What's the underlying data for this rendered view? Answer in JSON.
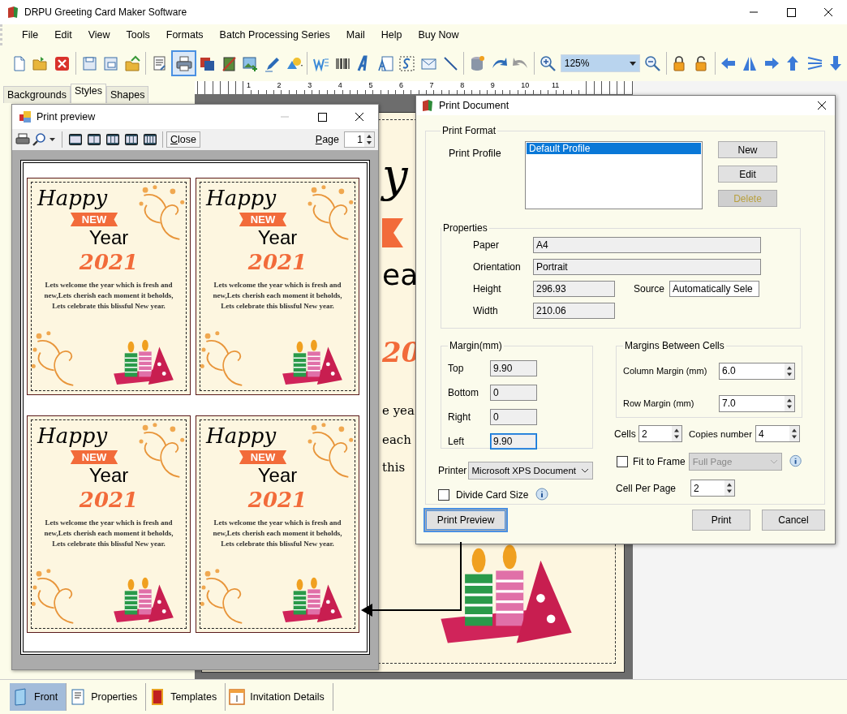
{
  "window": {
    "title": "DRPU Greeting Card Maker Software"
  },
  "menu": [
    "File",
    "Edit",
    "View",
    "Tools",
    "Formats",
    "Batch Processing Series",
    "Mail",
    "Help",
    "Buy Now"
  ],
  "toolbar": {
    "print_selected": true,
    "zoom": "125%"
  },
  "side_tabs": [
    {
      "label": "Backgrounds",
      "selected": false
    },
    {
      "label": "Styles",
      "selected": true
    },
    {
      "label": "Shapes",
      "selected": false
    }
  ],
  "ruler": [
    "1",
    "2",
    "3",
    "4",
    "5",
    "6",
    "7",
    "8",
    "9",
    "10",
    "11"
  ],
  "background_card": {
    "fragments": [
      "y",
      "ea",
      "20",
      "e yea",
      "each",
      "this"
    ]
  },
  "print_preview": {
    "title": "Print preview",
    "close_label": "Close",
    "page_label": "Page",
    "page": "1",
    "cards": [
      {
        "greeting": "Happy",
        "badge": "NEW",
        "title": "Year",
        "year": "2021",
        "message": [
          "Lets welcome the year which is fresh and",
          "new,Lets cherish each moment it beholds,",
          "Lets celebrate this blissful New year."
        ]
      },
      {
        "greeting": "Happy",
        "badge": "NEW",
        "title": "Year",
        "year": "2021",
        "message": [
          "Lets welcome the year which is fresh and",
          "new,Lets cherish each moment it beholds,",
          "Lets celebrate this blissful New year."
        ]
      },
      {
        "greeting": "Happy",
        "badge": "NEW",
        "title": "Year",
        "year": "2021",
        "message": [
          "Lets welcome the year which is fresh and",
          "new,Lets cherish each moment it beholds,",
          "Lets celebrate this blissful New year."
        ]
      },
      {
        "greeting": "Happy",
        "badge": "NEW",
        "title": "Year",
        "year": "2021",
        "message": [
          "Lets welcome the year which is fresh and",
          "new,Lets cherish each moment it beholds,",
          "Lets celebrate this blissful New year."
        ]
      }
    ]
  },
  "print_document": {
    "title": "Print Document",
    "print_format": {
      "legend": "Print Format",
      "profile_label": "Print Profile",
      "profiles": [
        {
          "name": "Default Profile",
          "selected": true
        }
      ],
      "buttons": [
        {
          "label": "New",
          "disabled": false
        },
        {
          "label": "Edit",
          "disabled": false
        },
        {
          "label": "Delete",
          "disabled": true
        }
      ]
    },
    "properties": {
      "legend": "Properties",
      "paper": {
        "label": "Paper",
        "value": "A4"
      },
      "orientation": {
        "label": "Orientation",
        "value": "Portrait"
      },
      "height": {
        "label": "Height",
        "value": "296.93"
      },
      "source": {
        "label": "Source",
        "value": "Automatically Sele"
      },
      "width": {
        "label": "Width",
        "value": "210.06"
      }
    },
    "margin": {
      "legend": "Margin(mm)",
      "fields": [
        {
          "label": "Top",
          "value": "9.90",
          "focused": false
        },
        {
          "label": "Bottom",
          "value": "0",
          "focused": false
        },
        {
          "label": "Right",
          "value": "0",
          "focused": false
        },
        {
          "label": "Left",
          "value": "9.90",
          "focused": true
        }
      ]
    },
    "cell_margins": {
      "legend": "Margins Between Cells",
      "fields": [
        {
          "label": "Column Margin (mm)",
          "value": "6.0"
        },
        {
          "label": "Row Margin (mm)",
          "value": "7.0"
        }
      ]
    },
    "cells": {
      "label": "Cells",
      "value": "2"
    },
    "copies": {
      "label": "Copies number",
      "value": "4"
    },
    "fit_to_frame": {
      "label": "Fit to Frame",
      "checked": false,
      "option": "Full Page",
      "option_disabled": true
    },
    "cell_per_page": {
      "label": "Cell Per Page",
      "value": "2"
    },
    "printer": {
      "label": "Printer",
      "value": "Microsoft XPS Document"
    },
    "divide_card_size": {
      "label": "Divide Card Size",
      "checked": false
    },
    "buttons": [
      {
        "label": "Print Preview",
        "focused": true
      },
      {
        "label": "Print",
        "focused": false
      },
      {
        "label": "Cancel",
        "focused": false
      }
    ]
  },
  "bottom_tabs": [
    {
      "label": "Front",
      "selected": true
    },
    {
      "label": "Properties",
      "selected": false
    },
    {
      "label": "Templates",
      "selected": false
    },
    {
      "label": "Invitation Details",
      "selected": false
    }
  ]
}
